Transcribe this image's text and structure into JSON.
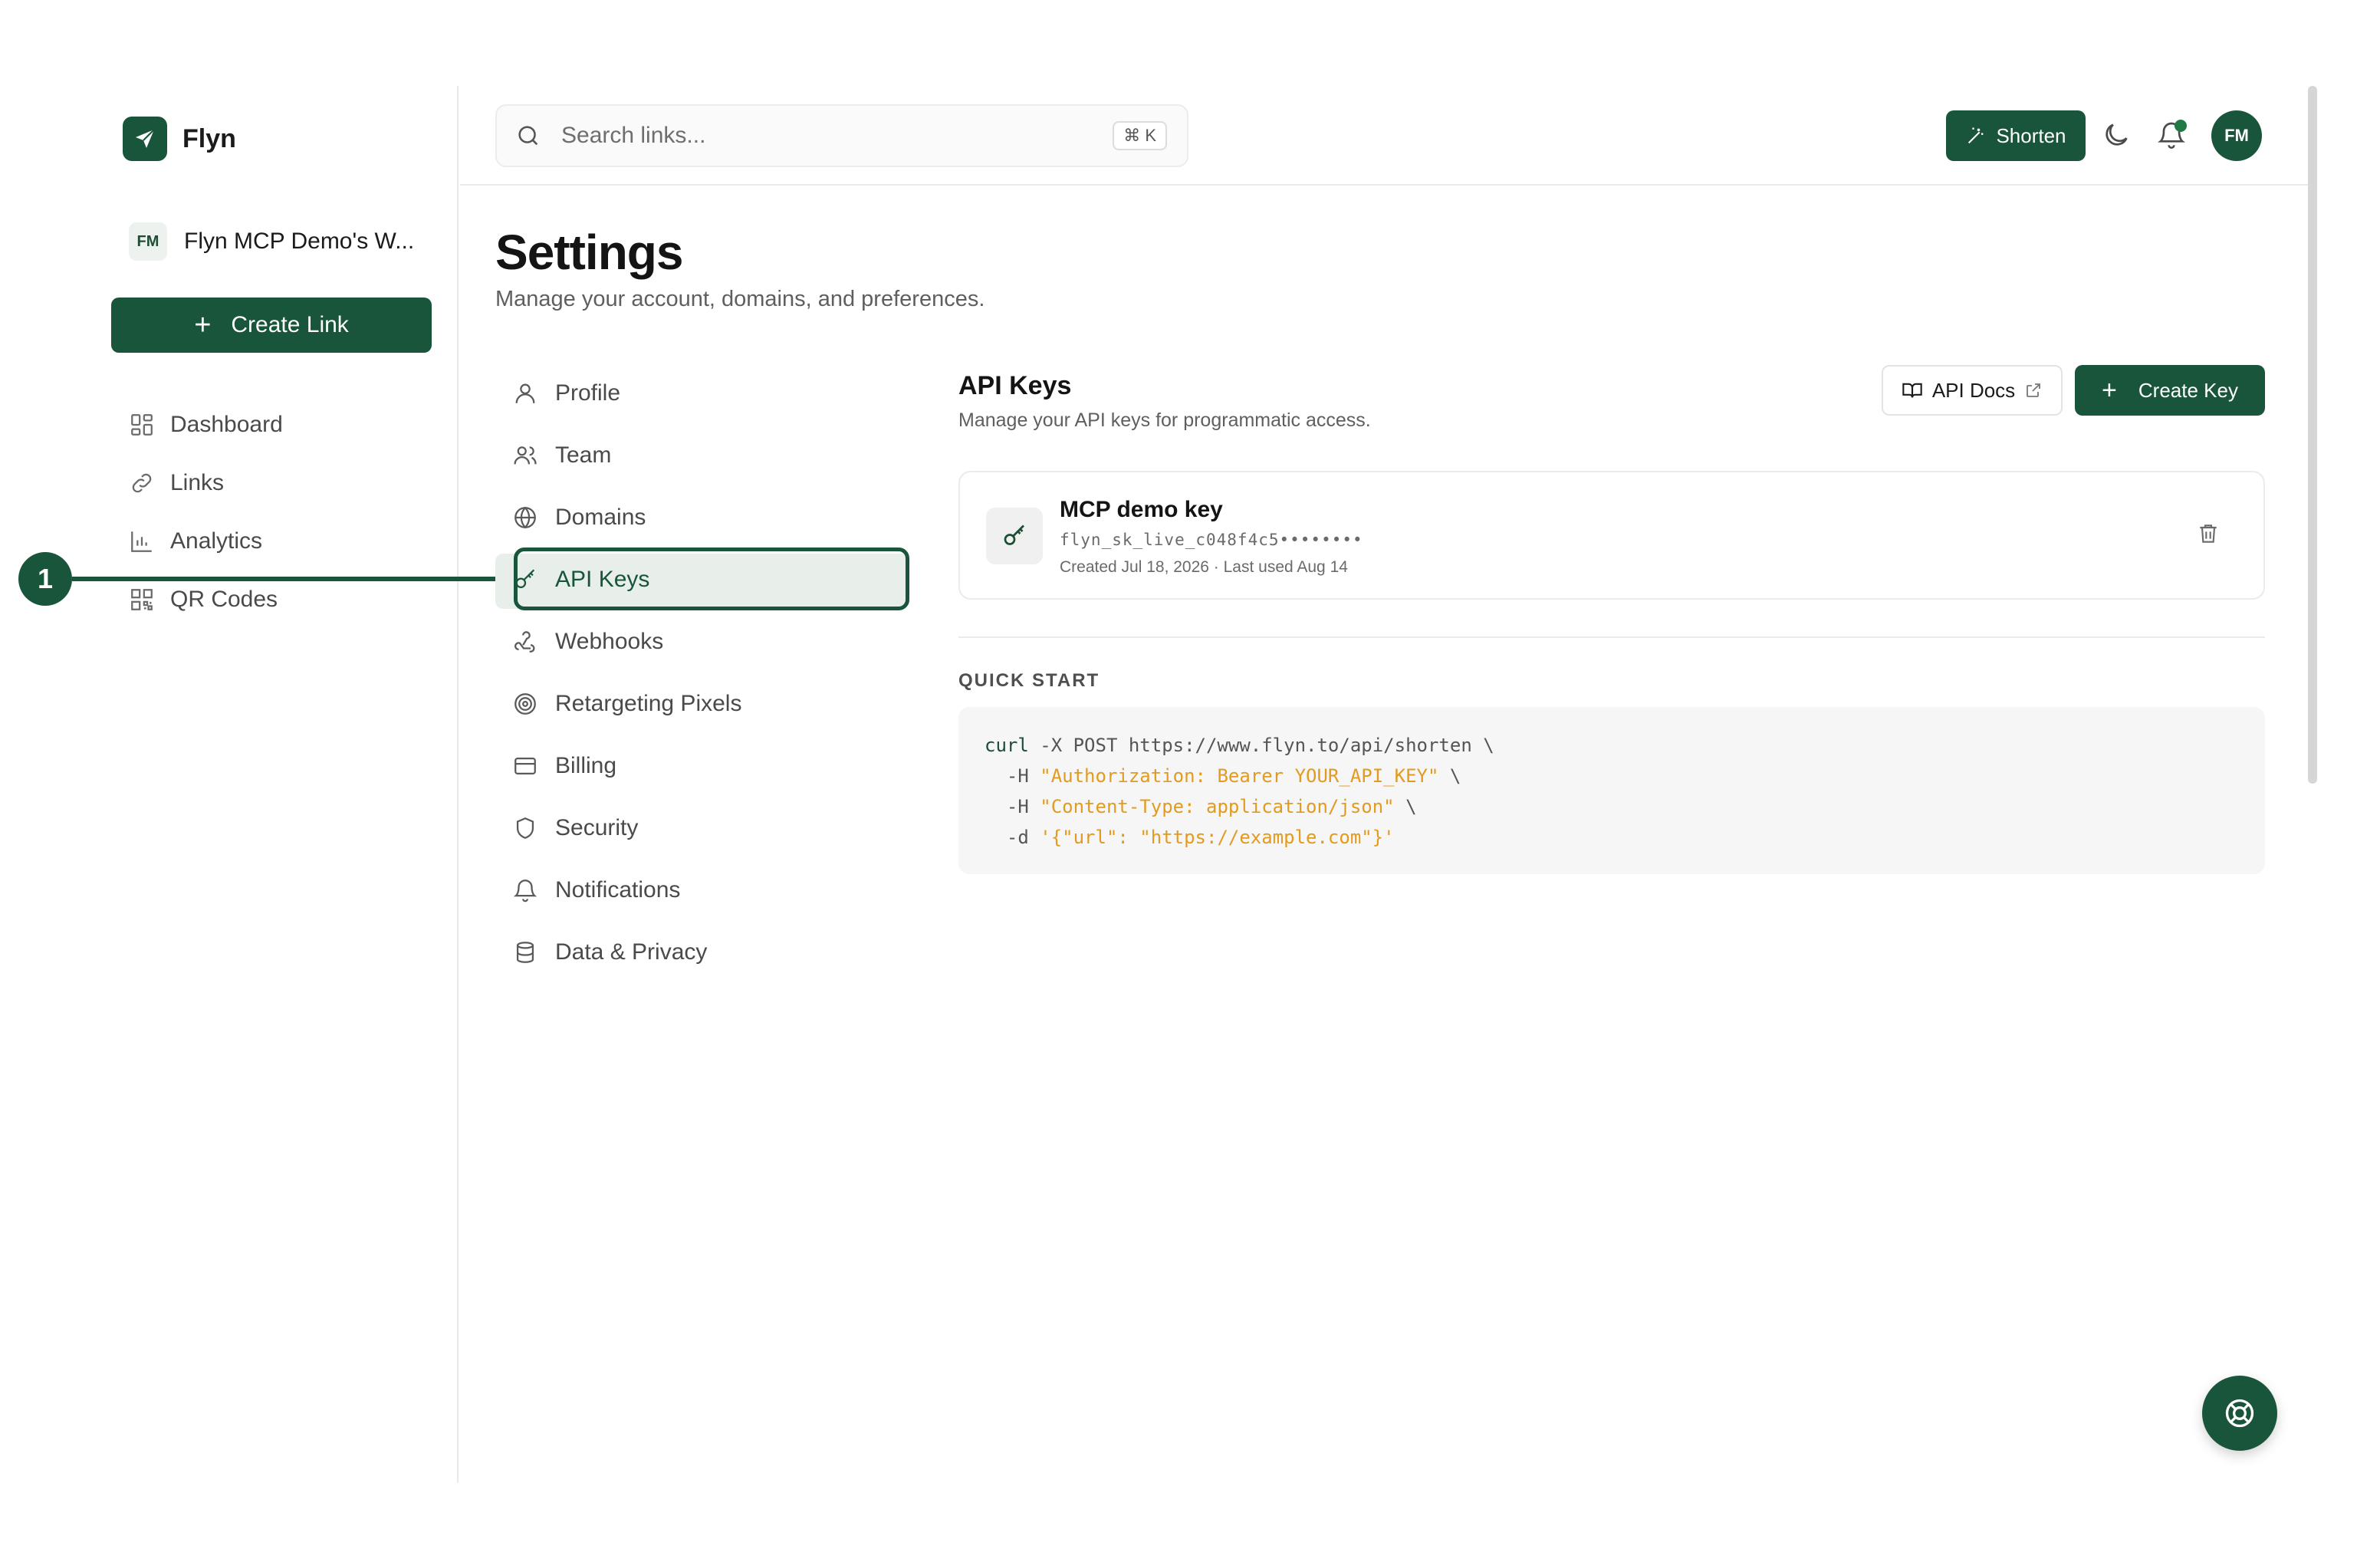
{
  "brand": {
    "name": "Flyn"
  },
  "workspace": {
    "badge": "FM",
    "name": "Flyn MCP Demo's W..."
  },
  "sidebar": {
    "create_label": "Create Link",
    "items": [
      {
        "label": "Dashboard",
        "icon": "dashboard-icon"
      },
      {
        "label": "Links",
        "icon": "link-icon"
      },
      {
        "label": "Analytics",
        "icon": "analytics-icon"
      },
      {
        "label": "QR Codes",
        "icon": "qr-icon"
      }
    ]
  },
  "annotation": {
    "number": "1"
  },
  "topbar": {
    "search_placeholder": "Search links...",
    "shortcut": "⌘ K",
    "shorten_label": "Shorten",
    "avatar": "FM"
  },
  "page": {
    "title": "Settings",
    "subtitle": "Manage your account, domains, and preferences."
  },
  "settings_nav": [
    {
      "label": "Profile",
      "icon": "user-icon"
    },
    {
      "label": "Team",
      "icon": "team-icon"
    },
    {
      "label": "Domains",
      "icon": "globe-icon"
    },
    {
      "label": "API Keys",
      "icon": "key-icon",
      "active": true
    },
    {
      "label": "Webhooks",
      "icon": "webhook-icon"
    },
    {
      "label": "Retargeting Pixels",
      "icon": "target-icon"
    },
    {
      "label": "Billing",
      "icon": "credit-card-icon"
    },
    {
      "label": "Security",
      "icon": "shield-icon"
    },
    {
      "label": "Notifications",
      "icon": "bell-icon"
    },
    {
      "label": "Data & Privacy",
      "icon": "database-icon"
    }
  ],
  "api_keys": {
    "title": "API Keys",
    "subtitle": "Manage your API keys for programmatic access.",
    "docs_label": "API Docs",
    "create_label": "Create Key",
    "keys": [
      {
        "name": "MCP demo key",
        "value": "flyn_sk_live_c048f4c5••••••••",
        "meta": "Created Jul 18, 2026 · Last used Aug 14"
      }
    ],
    "quick_start_label": "QUICK START",
    "code": {
      "l1_cmd": "curl",
      "l1_rest": " -X POST https://www.flyn.to/api/shorten \\",
      "l2_flag": "  -H ",
      "l2_str": "\"Authorization: Bearer YOUR_API_KEY\"",
      "l2_end": " \\",
      "l3_flag": "  -H ",
      "l3_str": "\"Content-Type: application/json\"",
      "l3_end": " \\",
      "l4_flag": "  -d ",
      "l4_str": "'{\"url\": \"https://example.com\"}'"
    }
  },
  "colors": {
    "accent": "#19553a",
    "code_string": "#e29b1e"
  }
}
